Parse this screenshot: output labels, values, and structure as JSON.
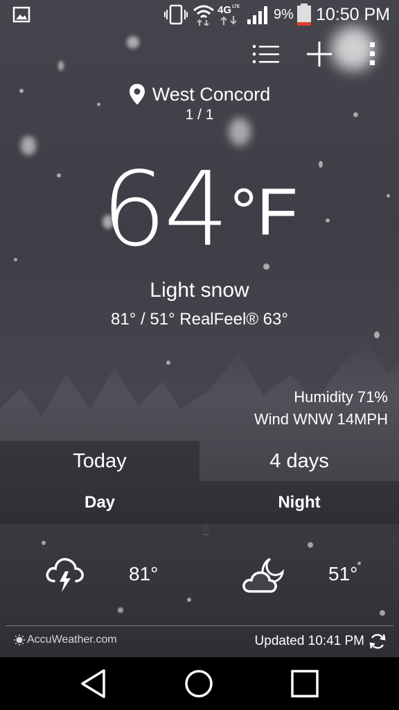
{
  "status_bar": {
    "network": "4G",
    "network_sub": "LTE",
    "battery_percent": "9%",
    "time": "10:50 PM",
    "icons": [
      "gallery-notification-icon",
      "vibrate-icon",
      "wifi-icon",
      "mobile-data-icon",
      "signal-icon",
      "battery-icon"
    ]
  },
  "toolbar": {
    "icons": [
      "list-icon",
      "add-icon",
      "more-vert-icon"
    ]
  },
  "location": {
    "name": "West Concord",
    "page_indicator": "1 / 1"
  },
  "current": {
    "temperature": "64",
    "unit": "°F",
    "condition": "Light snow",
    "hi_lo_realfeel": "81° / 51° RealFeel® 63°",
    "humidity": "Humidity 71%",
    "wind": "Wind WNW 14MPH"
  },
  "tabs": {
    "today": "Today",
    "four_days": "4 days"
  },
  "forecast": {
    "day_label": "Day",
    "night_label": "Night",
    "day_temp": "81°",
    "night_temp": "51°",
    "day_icon": "thunderstorm-icon",
    "night_icon": "partly-cloudy-night-icon"
  },
  "footer": {
    "brand": "AccuWeather.com",
    "updated": "Updated 10:41 PM"
  },
  "nav": {
    "icons": [
      "back-icon",
      "home-icon",
      "recents-icon"
    ]
  },
  "colors": {
    "background": "#44434b",
    "text": "#ffffff",
    "low_battery": "#e23b2e"
  }
}
